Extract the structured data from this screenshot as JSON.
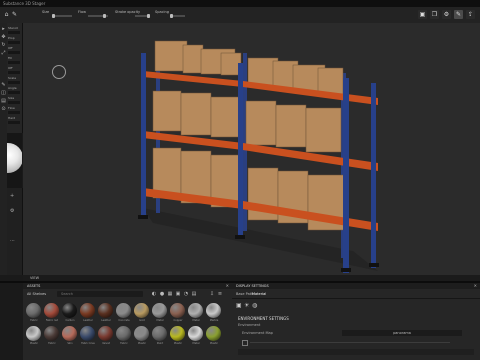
{
  "window": {
    "title": "Substance 3D Stager"
  },
  "toolbar": {
    "size_label": "Size",
    "flow_label": "Flow",
    "stroke_opacity_label": "Stroke opacity",
    "spacing_label": "Spacing",
    "material_label": "Material"
  },
  "left_params": {
    "labels": [
      "Stencil",
      "Prop",
      "Off",
      "Fill",
      "Off",
      "Scale",
      "Angle",
      "Size",
      "Flow",
      "Hard"
    ]
  },
  "viewport": {
    "label": "VIEW"
  },
  "assets": {
    "title": "ASSETS",
    "filter_label": "All Shelves",
    "search_placeholder": "Search",
    "swatches": [
      {
        "label": "Fabric",
        "color": "#6b6b6b"
      },
      {
        "label": "Fabric red",
        "color": "#a34a3a"
      },
      {
        "label": "Carbon",
        "color": "#1a1a1a"
      },
      {
        "label": "Leather",
        "color": "#7a3a22"
      },
      {
        "label": "Leather",
        "color": "#5a3020"
      },
      {
        "label": "Concrete",
        "color": "#8a8a8a"
      },
      {
        "label": "Gold",
        "color": "#b89a60"
      },
      {
        "label": "Metal",
        "color": "#9a9a9a"
      },
      {
        "label": "Copper",
        "color": "#8a6050"
      },
      {
        "label": "Metal",
        "color": "#b0b0b0"
      },
      {
        "label": "Marble",
        "color": "#c9c9c9"
      },
      {
        "label": "Plastic",
        "color": "#c9c9c9"
      },
      {
        "label": "Fabric",
        "color": "#4a3a36"
      },
      {
        "label": "Skin",
        "color": "#b56a5a"
      },
      {
        "label": "Fabric blue",
        "color": "#3a4a6a"
      },
      {
        "label": "Velvet",
        "color": "#7a3a30"
      },
      {
        "label": "Fabric",
        "color": "#6a6a6a"
      },
      {
        "label": "Plastic",
        "color": "#8a8a8a"
      },
      {
        "label": "Paint",
        "color": "#6a6a6a"
      },
      {
        "label": "Plastic",
        "color": "#b8b820"
      },
      {
        "label": "Metal",
        "color": "#d8d8d8"
      },
      {
        "label": "Plastic",
        "color": "#8aa030"
      }
    ]
  },
  "display": {
    "title": "DISPLAY SETTINGS",
    "tab_1": "Base Path",
    "tab_2": "Material",
    "env_title": "ENVIRONMENT SETTINGS",
    "env_sub": "Environment",
    "env_field_label": "Environment Map",
    "env_field_value": "panorama"
  }
}
